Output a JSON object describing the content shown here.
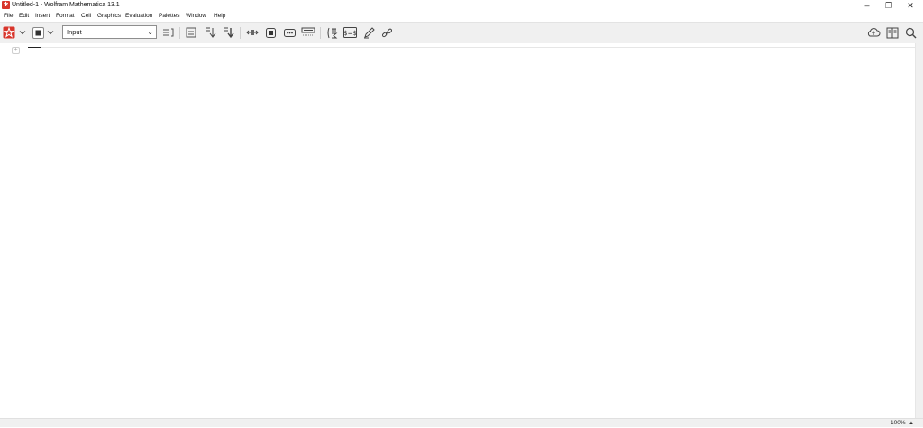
{
  "window": {
    "title": "Untitled-1 - Wolfram Mathematica 13.1",
    "minimize": "–",
    "restore": "❐",
    "close": "✕"
  },
  "menu": [
    "File",
    "Edit",
    "Insert",
    "Format",
    "Cell",
    "Graphics",
    "Evaluation",
    "Palettes",
    "Window",
    "Help"
  ],
  "toolbar": {
    "style_select": "Input",
    "icons": [
      "evaluate-icon",
      "abort-icon",
      "cell-bracket-icon",
      "above-below-icon",
      "output-icon",
      "split-cell-icon",
      "compress-icon",
      "ellipsis-icon",
      "template-icon",
      "sum-icon",
      "math-inline-icon",
      "pencil-icon",
      "link-icon",
      "cloud-upload-icon",
      "book-icon",
      "search-icon"
    ]
  },
  "notebook": {
    "insert_marker": "+"
  },
  "status": {
    "zoom": "100%",
    "zoom_button": "▲"
  },
  "colors": {
    "app_icon": "#d8352b",
    "toolbar_bg": "#f0f0f0"
  }
}
